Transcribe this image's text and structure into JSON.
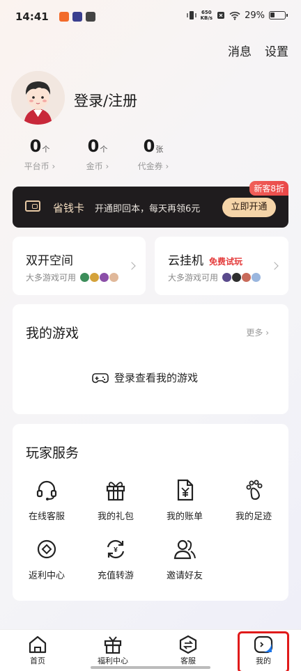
{
  "status_bar": {
    "time": "14:41",
    "speed_value": "650",
    "speed_unit": "KB/s",
    "battery": "29%"
  },
  "top_links": {
    "messages": "消息",
    "settings": "设置"
  },
  "profile": {
    "login_label": "登录/注册"
  },
  "stats": [
    {
      "value": "0",
      "unit": "个",
      "label": "平台币"
    },
    {
      "value": "0",
      "unit": "个",
      "label": "金币"
    },
    {
      "value": "0",
      "unit": "张",
      "label": "代金券"
    }
  ],
  "vip": {
    "badge": "新客8折",
    "title": "省钱卡",
    "desc": "开通即回本，每天再领6元",
    "button": "立即开通"
  },
  "dual_space": {
    "title": "双开空间",
    "subtitle": "大多游戏可用"
  },
  "cloud": {
    "title": "云挂机",
    "tag": "免费试玩",
    "subtitle": "大多游戏可用"
  },
  "my_games": {
    "title": "我的游戏",
    "more": "更多",
    "login_prompt": "登录查看我的游戏"
  },
  "services": {
    "title": "玩家服务",
    "items": [
      {
        "label": "在线客服",
        "icon": "headset-icon"
      },
      {
        "label": "我的礼包",
        "icon": "gift-icon"
      },
      {
        "label": "我的账单",
        "icon": "bill-icon"
      },
      {
        "label": "我的足迹",
        "icon": "footprint-icon"
      },
      {
        "label": "返利中心",
        "icon": "rebate-icon"
      },
      {
        "label": "充值转游",
        "icon": "transfer-icon"
      },
      {
        "label": "邀请好友",
        "icon": "invite-icon"
      }
    ]
  },
  "tabbar": [
    {
      "label": "首页",
      "icon": "home-icon"
    },
    {
      "label": "福利中心",
      "icon": "gift-box-icon"
    },
    {
      "label": "客服",
      "icon": "service-icon"
    },
    {
      "label": "我的",
      "icon": "profile-icon"
    }
  ],
  "colors": {
    "accent_red": "#e01a1a",
    "vip_bg": "#1f1c1e",
    "vip_button": "#f5d4a8",
    "tag_red": "#e43a3a"
  }
}
